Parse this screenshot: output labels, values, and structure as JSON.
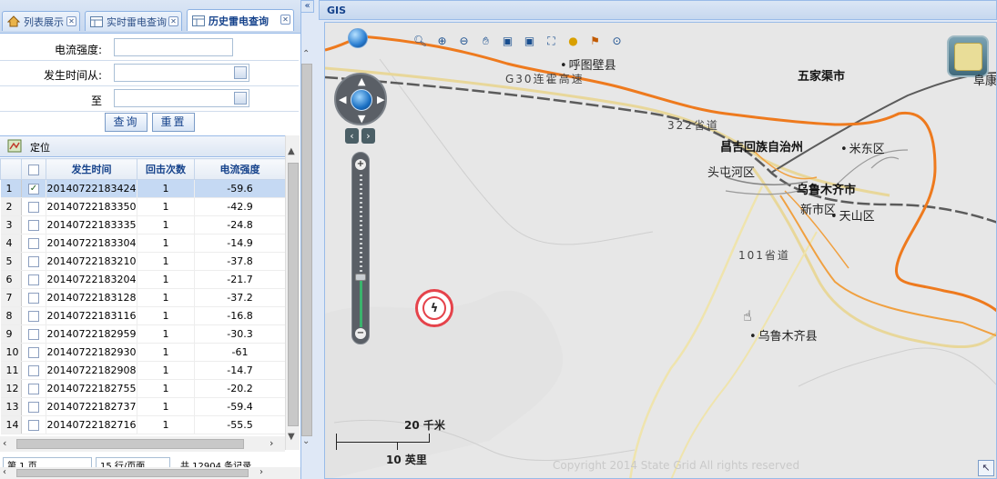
{
  "tabs": [
    {
      "label": "列表展示",
      "icon": "home-icon",
      "active": false
    },
    {
      "label": "实时雷电查询",
      "icon": "grid-icon",
      "active": false
    },
    {
      "label": "历史雷电查询",
      "icon": "grid-icon",
      "active": true
    }
  ],
  "form": {
    "current_label": "电流强度:",
    "current_value": "",
    "time_from_label": "发生时间从:",
    "time_from_value": "",
    "time_to_label": "至",
    "time_to_value": "",
    "query_button": "查询",
    "reset_button": "重置"
  },
  "grid": {
    "locate_label": "定位",
    "columns": [
      "发生时间",
      "回击次数",
      "电流强度"
    ],
    "rows": [
      {
        "n": "1",
        "time": "20140722183424",
        "strikes": "1",
        "current": "-59.6",
        "checked": true
      },
      {
        "n": "2",
        "time": "20140722183350",
        "strikes": "1",
        "current": "-42.9",
        "checked": false
      },
      {
        "n": "3",
        "time": "20140722183335",
        "strikes": "1",
        "current": "-24.8",
        "checked": false
      },
      {
        "n": "4",
        "time": "20140722183304",
        "strikes": "1",
        "current": "-14.9",
        "checked": false
      },
      {
        "n": "5",
        "time": "20140722183210",
        "strikes": "1",
        "current": "-37.8",
        "checked": false
      },
      {
        "n": "6",
        "time": "20140722183204",
        "strikes": "1",
        "current": "-21.7",
        "checked": false
      },
      {
        "n": "7",
        "time": "20140722183128",
        "strikes": "1",
        "current": "-37.2",
        "checked": false
      },
      {
        "n": "8",
        "time": "20140722183116",
        "strikes": "1",
        "current": "-16.8",
        "checked": false
      },
      {
        "n": "9",
        "time": "20140722182959",
        "strikes": "1",
        "current": "-30.3",
        "checked": false
      },
      {
        "n": "10",
        "time": "20140722182930",
        "strikes": "1",
        "current": "-61",
        "checked": false
      },
      {
        "n": "11",
        "time": "20140722182908",
        "strikes": "1",
        "current": "-14.7",
        "checked": false
      },
      {
        "n": "12",
        "time": "20140722182755",
        "strikes": "1",
        "current": "-20.2",
        "checked": false
      },
      {
        "n": "13",
        "time": "20140722182737",
        "strikes": "1",
        "current": "-59.4",
        "checked": false
      },
      {
        "n": "14",
        "time": "20140722182716",
        "strikes": "1",
        "current": "-55.5",
        "checked": false
      }
    ]
  },
  "pager": {
    "page_select": "第 1 页",
    "per_page_select": "15 行/页面",
    "total_text": "共 12904 条记录"
  },
  "gis": {
    "title": "GIS",
    "labels": {
      "hutubi": "呼图壁县",
      "g30": "G30连霍高速",
      "wujiaqu": "五家渠市",
      "s322": "322省道",
      "changji": "昌吉回族自治州",
      "midong": "米东区",
      "toutunhe": "头屯河区",
      "urumqi": "乌鲁木齐市",
      "xinshi": "新市区",
      "tianshan": "天山区",
      "s101": "101省道",
      "urumqi_county": "乌鲁木齐县",
      "right_edge": "阜康"
    },
    "scale_km": "20 千米",
    "scale_mi": "10 英里",
    "copyright": "Copyright 2014 State Grid All rights reserved"
  }
}
